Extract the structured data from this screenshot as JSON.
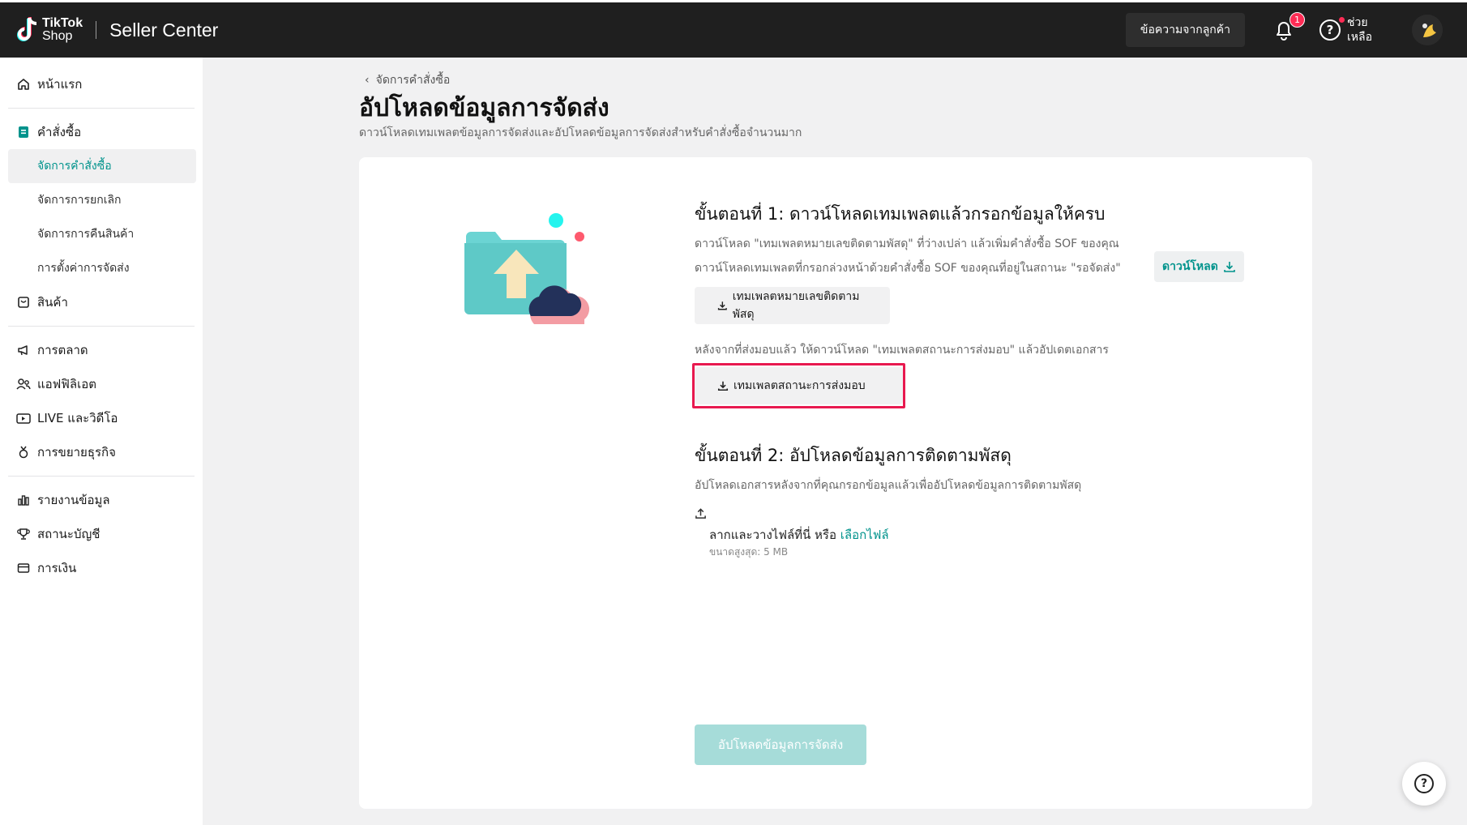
{
  "header": {
    "logo_line1": "TikTok",
    "logo_line2": "Shop",
    "app_title": "Seller Center",
    "messages_button": "ข้อความจากลูกค้า",
    "notification_count": "1",
    "help_label": "ช่วยเหลือ"
  },
  "sidebar": {
    "home": "หน้าแรก",
    "orders": "คำสั่งซื้อ",
    "orders_sub": [
      "จัดการคำสั่งซื้อ",
      "จัดการการยกเลิก",
      "จัดการการคืนสินค้า",
      "การตั้งค่าการจัดส่ง"
    ],
    "products": "สินค้า",
    "marketing": "การตลาด",
    "affiliate": "แอฟฟิลิเอต",
    "live_video": "LIVE และวิดีโอ",
    "growth": "การขยายธุรกิจ",
    "reports": "รายงานข้อมูล",
    "account_status": "สถานะบัญชี",
    "finance": "การเงิน"
  },
  "page": {
    "breadcrumb": "จัดการคำสั่งซื้อ",
    "title": "อัปโหลดข้อมูลการจัดส่ง",
    "subtitle": "ดาวน์โหลดเทมเพลตข้อมูลการจัดส่งและอัปโหลดข้อมูลการจัดส่งสำหรับคำสั่งซื้อจำนวนมาก"
  },
  "step1": {
    "title": "ขั้นตอนที่ 1: ดาวน์โหลดเทมเพลตแล้วกรอกข้อมูลให้ครบ",
    "line1": "ดาวน์โหลด \"เทมเพลตหมายเลขติดตามพัสดุ\" ที่ว่างเปล่า แล้วเพิ่มคำสั่งซื้อ SOF ของคุณ",
    "line2": "ดาวน์โหลดเทมเพลตที่กรอกล่วงหน้าด้วยคำสั่งซื้อ SOF ของคุณที่อยู่ในสถานะ \"รอจัดส่ง\"",
    "download_link": "ดาวน์โหลด",
    "tracking_template_button": "เทมเพลตหมายเลขติดตามพัสดุ",
    "after_delivery_text": "หลังจากที่ส่งมอบแล้ว ให้ดาวน์โหลด \"เทมเพลตสถานะการส่งมอบ\" แล้วอัปเดตเอกสาร",
    "delivery_status_button": "เทมเพลตสถานะการส่งมอบ"
  },
  "step2": {
    "title": "ขั้นตอนที่ 2: อัปโหลดข้อมูลการติดตามพัสดุ",
    "description": "อัปโหลดเอกสารหลังจากที่คุณกรอกข้อมูลแล้วเพื่ออัปโหลดข้อมูลการติดตามพัสดุ",
    "drop_text": "ลากและวางไฟล์ที่นี่ หรือ",
    "choose_file": "เลือกไฟล์",
    "max_size": "ขนาดสูงสุด: 5 MB"
  },
  "submit_button": "อัปโหลดข้อมูลการจัดส่ง",
  "colors": {
    "accent": "#00938c",
    "highlight": "#e8194f",
    "topbar": "#1f1f1f"
  }
}
